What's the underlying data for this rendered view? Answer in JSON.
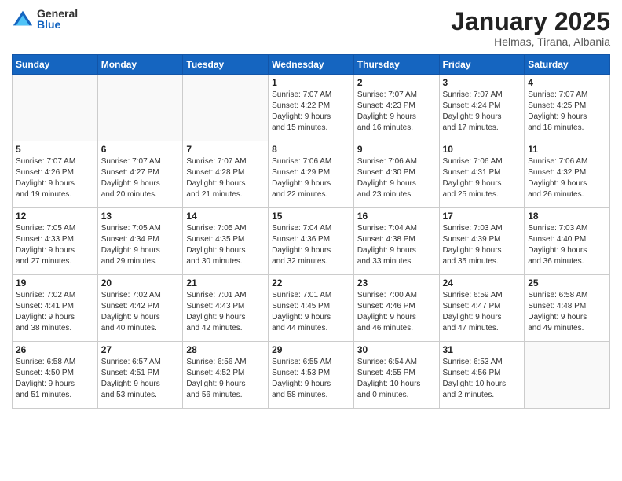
{
  "logo": {
    "general": "General",
    "blue": "Blue"
  },
  "title": {
    "month": "January 2025",
    "location": "Helmas, Tirana, Albania"
  },
  "weekdays": [
    "Sunday",
    "Monday",
    "Tuesday",
    "Wednesday",
    "Thursday",
    "Friday",
    "Saturday"
  ],
  "weeks": [
    [
      {
        "num": "",
        "detail": ""
      },
      {
        "num": "",
        "detail": ""
      },
      {
        "num": "",
        "detail": ""
      },
      {
        "num": "1",
        "detail": "Sunrise: 7:07 AM\nSunset: 4:22 PM\nDaylight: 9 hours\nand 15 minutes."
      },
      {
        "num": "2",
        "detail": "Sunrise: 7:07 AM\nSunset: 4:23 PM\nDaylight: 9 hours\nand 16 minutes."
      },
      {
        "num": "3",
        "detail": "Sunrise: 7:07 AM\nSunset: 4:24 PM\nDaylight: 9 hours\nand 17 minutes."
      },
      {
        "num": "4",
        "detail": "Sunrise: 7:07 AM\nSunset: 4:25 PM\nDaylight: 9 hours\nand 18 minutes."
      }
    ],
    [
      {
        "num": "5",
        "detail": "Sunrise: 7:07 AM\nSunset: 4:26 PM\nDaylight: 9 hours\nand 19 minutes."
      },
      {
        "num": "6",
        "detail": "Sunrise: 7:07 AM\nSunset: 4:27 PM\nDaylight: 9 hours\nand 20 minutes."
      },
      {
        "num": "7",
        "detail": "Sunrise: 7:07 AM\nSunset: 4:28 PM\nDaylight: 9 hours\nand 21 minutes."
      },
      {
        "num": "8",
        "detail": "Sunrise: 7:06 AM\nSunset: 4:29 PM\nDaylight: 9 hours\nand 22 minutes."
      },
      {
        "num": "9",
        "detail": "Sunrise: 7:06 AM\nSunset: 4:30 PM\nDaylight: 9 hours\nand 23 minutes."
      },
      {
        "num": "10",
        "detail": "Sunrise: 7:06 AM\nSunset: 4:31 PM\nDaylight: 9 hours\nand 25 minutes."
      },
      {
        "num": "11",
        "detail": "Sunrise: 7:06 AM\nSunset: 4:32 PM\nDaylight: 9 hours\nand 26 minutes."
      }
    ],
    [
      {
        "num": "12",
        "detail": "Sunrise: 7:05 AM\nSunset: 4:33 PM\nDaylight: 9 hours\nand 27 minutes."
      },
      {
        "num": "13",
        "detail": "Sunrise: 7:05 AM\nSunset: 4:34 PM\nDaylight: 9 hours\nand 29 minutes."
      },
      {
        "num": "14",
        "detail": "Sunrise: 7:05 AM\nSunset: 4:35 PM\nDaylight: 9 hours\nand 30 minutes."
      },
      {
        "num": "15",
        "detail": "Sunrise: 7:04 AM\nSunset: 4:36 PM\nDaylight: 9 hours\nand 32 minutes."
      },
      {
        "num": "16",
        "detail": "Sunrise: 7:04 AM\nSunset: 4:38 PM\nDaylight: 9 hours\nand 33 minutes."
      },
      {
        "num": "17",
        "detail": "Sunrise: 7:03 AM\nSunset: 4:39 PM\nDaylight: 9 hours\nand 35 minutes."
      },
      {
        "num": "18",
        "detail": "Sunrise: 7:03 AM\nSunset: 4:40 PM\nDaylight: 9 hours\nand 36 minutes."
      }
    ],
    [
      {
        "num": "19",
        "detail": "Sunrise: 7:02 AM\nSunset: 4:41 PM\nDaylight: 9 hours\nand 38 minutes."
      },
      {
        "num": "20",
        "detail": "Sunrise: 7:02 AM\nSunset: 4:42 PM\nDaylight: 9 hours\nand 40 minutes."
      },
      {
        "num": "21",
        "detail": "Sunrise: 7:01 AM\nSunset: 4:43 PM\nDaylight: 9 hours\nand 42 minutes."
      },
      {
        "num": "22",
        "detail": "Sunrise: 7:01 AM\nSunset: 4:45 PM\nDaylight: 9 hours\nand 44 minutes."
      },
      {
        "num": "23",
        "detail": "Sunrise: 7:00 AM\nSunset: 4:46 PM\nDaylight: 9 hours\nand 46 minutes."
      },
      {
        "num": "24",
        "detail": "Sunrise: 6:59 AM\nSunset: 4:47 PM\nDaylight: 9 hours\nand 47 minutes."
      },
      {
        "num": "25",
        "detail": "Sunrise: 6:58 AM\nSunset: 4:48 PM\nDaylight: 9 hours\nand 49 minutes."
      }
    ],
    [
      {
        "num": "26",
        "detail": "Sunrise: 6:58 AM\nSunset: 4:50 PM\nDaylight: 9 hours\nand 51 minutes."
      },
      {
        "num": "27",
        "detail": "Sunrise: 6:57 AM\nSunset: 4:51 PM\nDaylight: 9 hours\nand 53 minutes."
      },
      {
        "num": "28",
        "detail": "Sunrise: 6:56 AM\nSunset: 4:52 PM\nDaylight: 9 hours\nand 56 minutes."
      },
      {
        "num": "29",
        "detail": "Sunrise: 6:55 AM\nSunset: 4:53 PM\nDaylight: 9 hours\nand 58 minutes."
      },
      {
        "num": "30",
        "detail": "Sunrise: 6:54 AM\nSunset: 4:55 PM\nDaylight: 10 hours\nand 0 minutes."
      },
      {
        "num": "31",
        "detail": "Sunrise: 6:53 AM\nSunset: 4:56 PM\nDaylight: 10 hours\nand 2 minutes."
      },
      {
        "num": "",
        "detail": ""
      }
    ]
  ]
}
